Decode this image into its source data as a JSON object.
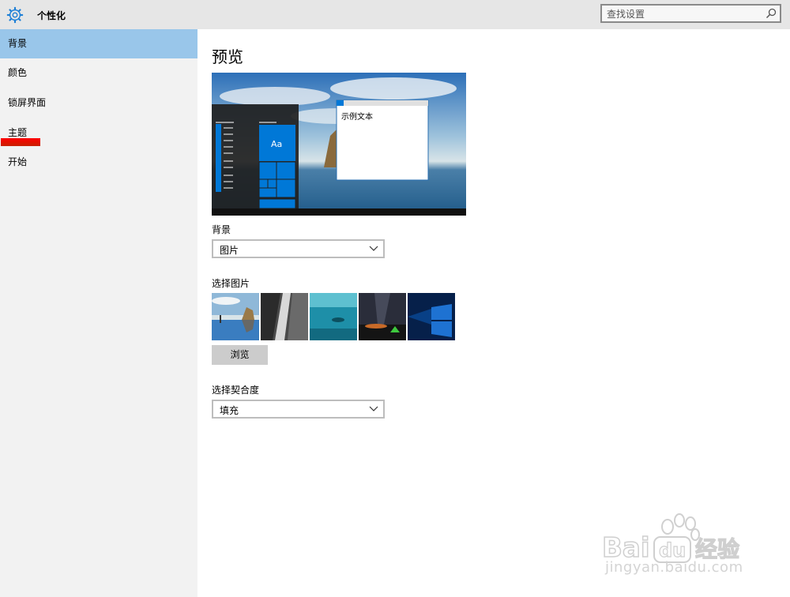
{
  "header": {
    "title": "个性化",
    "search_placeholder": "查找设置"
  },
  "sidebar": {
    "items": [
      {
        "label": "背景",
        "active": true
      },
      {
        "label": "颜色",
        "active": false
      },
      {
        "label": "锁屏界面",
        "active": false
      },
      {
        "label": "主题",
        "active": false
      },
      {
        "label": "开始",
        "active": false
      }
    ]
  },
  "main": {
    "preview_heading": "预览",
    "preview_sample_text": "示例文本",
    "preview_tile_text": "Aa",
    "background_label": "背景",
    "background_value": "图片",
    "choose_picture_label": "选择图片",
    "browse_label": "浏览",
    "fit_label": "选择契合度",
    "fit_value": "填充"
  },
  "watermark": {
    "logo_text": "Bai du 经验",
    "url": "jingyan.baidu.com"
  },
  "colors": {
    "accent": "#0078d7",
    "selected_nav": "#99c6ea"
  }
}
